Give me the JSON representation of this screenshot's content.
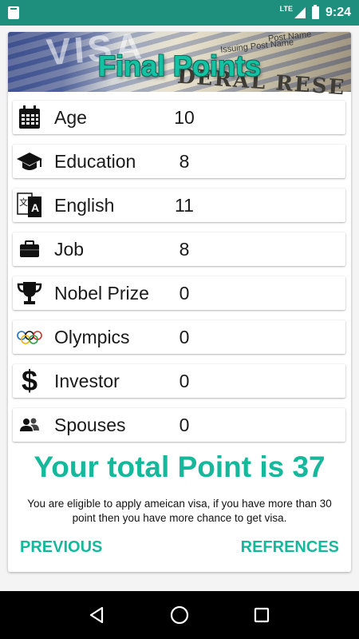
{
  "status_bar": {
    "network": "LTE",
    "time": "9:24",
    "icons": [
      "sd-card-icon",
      "signal-icon",
      "battery-icon"
    ]
  },
  "header": {
    "title": "Final Points",
    "image_text": {
      "visa": "VISA",
      "issuing_post_name": "Issuing Post Name",
      "post_name": "Post Name",
      "reserve": "DERAL RESE"
    }
  },
  "rows": [
    {
      "icon": "calendar-icon",
      "label": "Age",
      "value": "10"
    },
    {
      "icon": "graduation-cap-icon",
      "label": "Education",
      "value": "8"
    },
    {
      "icon": "translate-icon",
      "label": "English",
      "value": "11"
    },
    {
      "icon": "briefcase-icon",
      "label": "Job",
      "value": "8"
    },
    {
      "icon": "trophy-icon",
      "label": "Nobel Prize",
      "value": "0"
    },
    {
      "icon": "olympic-rings-icon",
      "label": "Olympics",
      "value": "0"
    },
    {
      "icon": "dollar-icon",
      "label": "Investor",
      "value": "0"
    },
    {
      "icon": "people-icon",
      "label": "Spouses",
      "value": "0"
    }
  ],
  "total_text": "Your total Point is 37",
  "note": "You are eligible to apply ameican visa, if you have more than 30 point then you have more chance to get visa.",
  "buttons": {
    "previous": "PREVIOUS",
    "references": "REFRENCES"
  },
  "nav_bar": [
    "back-icon",
    "home-icon",
    "recents-icon"
  ],
  "colors": {
    "status_bar": "#1d8f7c",
    "accent": "#15b89b",
    "title": "#14c1a3",
    "nav_bar": "#000000"
  }
}
